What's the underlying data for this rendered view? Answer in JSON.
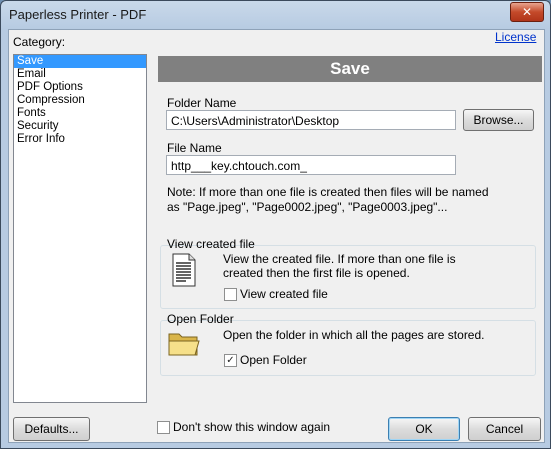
{
  "window": {
    "title": "Paperless Printer - PDF",
    "close_label": "✕"
  },
  "license_link": "License",
  "category_label": "Category:",
  "categories": [
    "Save",
    "Email",
    "PDF Options",
    "Compression",
    "Fonts",
    "Security",
    "Error Info"
  ],
  "selected_category": "Save",
  "panel": {
    "header": "Save",
    "folder_name_label": "Folder Name",
    "folder_name_value": "C:\\Users\\Administrator\\Desktop",
    "browse_label": "Browse...",
    "file_name_label": "File Name",
    "file_name_value": "http___key.chtouch.com_",
    "note_line1": "Note: If more than one file is created then files will be named",
    "note_line2": "as \"Page.jpeg\", \"Page0002.jpeg\", \"Page0003.jpeg\"...",
    "view_group": {
      "title": "View created file",
      "desc_line1": "View the created file. If more than one file is",
      "desc_line2": "created then the first file is opened.",
      "checkbox_label": "View created file",
      "checked": false
    },
    "open_group": {
      "title": "Open Folder",
      "desc": "Open the folder in which all the pages are stored.",
      "checkbox_label": "Open Folder",
      "checked": true
    }
  },
  "footer": {
    "defaults_label": "Defaults...",
    "dont_show_label": "Don't show this window again",
    "dont_show_checked": false,
    "ok_label": "OK",
    "cancel_label": "Cancel"
  }
}
